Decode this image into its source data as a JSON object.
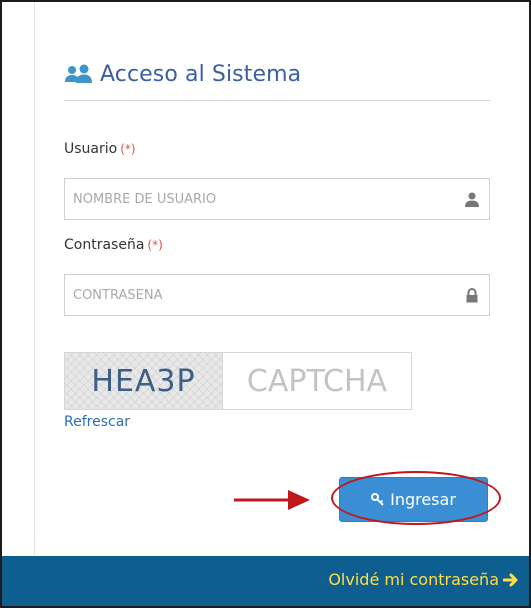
{
  "login": {
    "title": "Acceso al Sistema",
    "username_label": "Usuario",
    "password_label": "Contraseña",
    "required_mark": "(*)",
    "username_placeholder": "NOMBRE DE USUARIO",
    "password_placeholder": "CONTRASEÑA",
    "captcha_code": "HEA3P",
    "captcha_placeholder": "CAPTCHA",
    "refresh_label": "Refrescar",
    "submit_label": "Ingresar",
    "forgot_label": "Olvidé mi contraseña"
  },
  "icons": {
    "heading": "users-icon",
    "username": "user-icon",
    "password": "lock-icon",
    "submit": "key-icon",
    "forgot": "arrow-right-icon"
  },
  "colors": {
    "title": "#3b5fa3",
    "required": "#d9534f",
    "button": "#3a8fd4",
    "footer": "#0e5f8f",
    "footer_link": "#ffdf43",
    "annotation": "#c0161c"
  }
}
